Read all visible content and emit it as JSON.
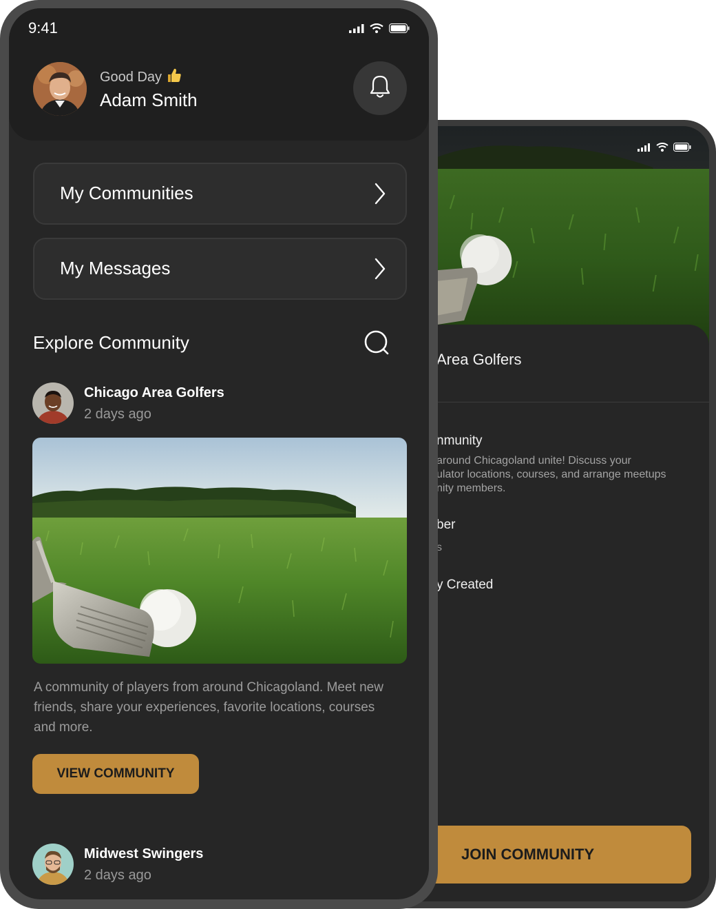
{
  "colors": {
    "accent": "#c08b3c",
    "screen_bg": "#262626",
    "header_bg": "#1f1f1f",
    "card_bg": "#2d2d2d"
  },
  "status_bar": {
    "time": "9:41"
  },
  "header": {
    "greeting": "Good Day",
    "greeting_icon": "thumbs-up-emoji",
    "user_name": "Adam Smith",
    "notification_icon": "bell-icon"
  },
  "nav": [
    {
      "label": "My Communities",
      "icon": "chevron-right-icon"
    },
    {
      "label": "My Messages",
      "icon": "chevron-right-icon"
    }
  ],
  "explore": {
    "title": "Explore Community",
    "search_icon": "search-icon"
  },
  "posts": [
    {
      "name": "Chicago Area Golfers",
      "time": "2 days ago",
      "description": "A community of players from around Chicagoland.  Meet new friends, share your experiences, favorite locations, courses and more.",
      "button": "VIEW COMMUNITY"
    },
    {
      "name": "Midwest Swingers",
      "time": "2 days ago"
    }
  ],
  "detail": {
    "title_fragment": "Area Golfers",
    "section_community": "nmunity",
    "description_lines": [
      "around Chicagoland unite!  Discuss your",
      "ulator locations, courses, and arrange meetups",
      "nity members."
    ],
    "section_member": "ber",
    "member_sub": "s",
    "section_created": "y Created",
    "button": "JOIN COMMUNITY"
  }
}
